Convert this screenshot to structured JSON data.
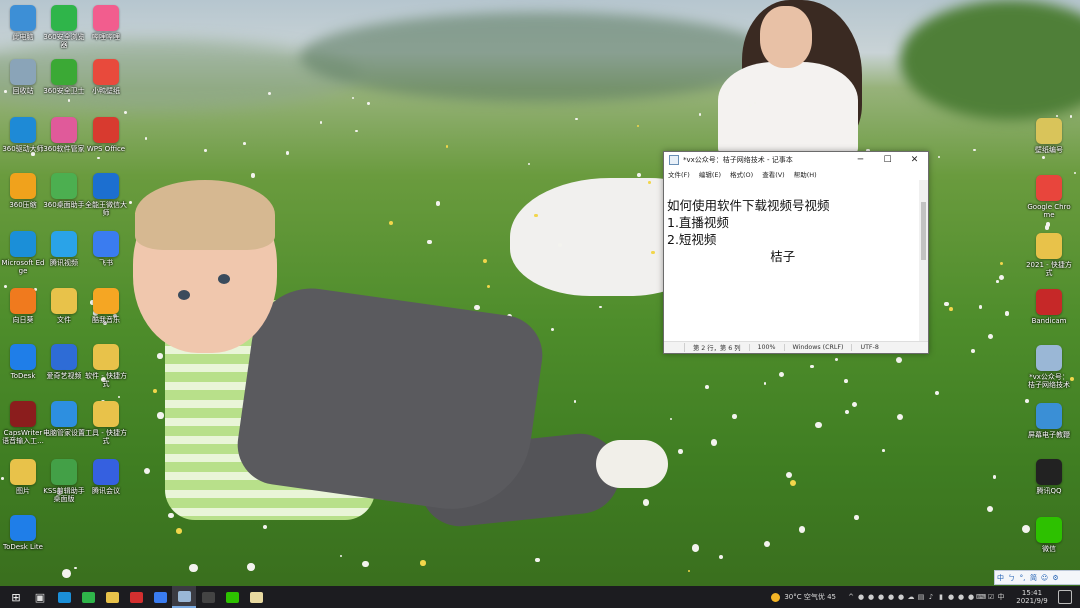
{
  "desktop": {
    "icons": [
      {
        "label": "此电脑",
        "icon": "computer-icon",
        "color": "#3d8fd6"
      },
      {
        "label": "360安全浏览器",
        "icon": "browser-360-icon",
        "color": "#2fb54a"
      },
      {
        "label": "哔哩哔哩",
        "icon": "bilibili-icon",
        "color": "#f25d8e"
      },
      {
        "label": "回收站",
        "icon": "recycle-bin-icon",
        "color": "#8aa4b8"
      },
      {
        "label": "360安全卫士",
        "icon": "security-360-icon",
        "color": "#3ba935"
      },
      {
        "label": "小鸭壁纸",
        "icon": "wallpaper-app-icon",
        "color": "#e84a3c"
      },
      {
        "label": "360驱动大师",
        "icon": "driver-360-icon",
        "color": "#1e8ad6"
      },
      {
        "label": "360软件管家",
        "icon": "software-manager-icon",
        "color": "#e05a9a"
      },
      {
        "label": "WPS Office",
        "icon": "wps-office-icon",
        "color": "#d83a2f"
      },
      {
        "label": "360压缩",
        "icon": "compress-360-icon",
        "color": "#f0a21c"
      },
      {
        "label": "360桌面助手",
        "icon": "desktop-assistant-icon",
        "color": "#4caf50"
      },
      {
        "label": "全能王微信大师",
        "icon": "wechat-master-icon",
        "color": "#1c6fd0"
      },
      {
        "label": "Microsoft Edge",
        "icon": "edge-icon",
        "color": "#1b8fd8"
      },
      {
        "label": "腾讯视频",
        "icon": "tencent-video-icon",
        "color": "#2aa3e8"
      },
      {
        "label": "飞书",
        "icon": "feishu-icon",
        "color": "#3a7cf0"
      },
      {
        "label": "向日葵",
        "icon": "sunflower-icon",
        "color": "#f07a1e"
      },
      {
        "label": "文件",
        "icon": "folder-icon",
        "color": "#e8c24a"
      },
      {
        "label": "酷我音乐",
        "icon": "kuwo-music-icon",
        "color": "#f5a623"
      },
      {
        "label": "ToDesk",
        "icon": "todesk-icon",
        "color": "#1f7ee8"
      },
      {
        "label": "爱奇艺视频",
        "icon": "iqiyi-icon",
        "color": "#2e6cd6"
      },
      {
        "label": "软件 - 快捷方式",
        "icon": "shortcut-folder-icon",
        "color": "#e8c24a"
      },
      {
        "label": "CapsWriter 语音输入工...",
        "icon": "capswriter-icon",
        "color": "#8b1d1d"
      },
      {
        "label": "电脑管家设置",
        "icon": "pc-manager-icon",
        "color": "#2d8fe0"
      },
      {
        "label": "工具 - 快捷方式",
        "icon": "tools-folder-icon",
        "color": "#e8c24a"
      },
      {
        "label": "图片",
        "icon": "pictures-folder-icon",
        "color": "#e8c24a"
      },
      {
        "label": "KSS剪辑助手桌面版",
        "icon": "kss-icon",
        "color": "#43a047"
      },
      {
        "label": "腾讯会议",
        "icon": "tencent-meeting-icon",
        "color": "#3560e0"
      },
      {
        "label": "ToDesk Lite",
        "icon": "todesk-lite-icon",
        "color": "#1f7ee8"
      }
    ],
    "right_icons": [
      {
        "label": "壁纸编号",
        "icon": "file-icon",
        "color": "#d9c45a"
      },
      {
        "label": "Google Chrome",
        "icon": "chrome-icon",
        "color": "#e8453c"
      },
      {
        "label": "2021 - 快捷方式",
        "icon": "folder-shortcut-icon",
        "color": "#e8c24a"
      },
      {
        "label": "Bandicam",
        "icon": "bandicam-icon",
        "color": "#c62828"
      },
      {
        "label": "*vx公众号：桔子网络技术",
        "icon": "text-file-icon",
        "color": "#9ab7d6"
      },
      {
        "label": "屏幕电子教鞭",
        "icon": "screen-pen-icon",
        "color": "#3a8fd6"
      },
      {
        "label": "腾讯QQ",
        "icon": "qq-icon",
        "color": "#222"
      },
      {
        "label": "微信",
        "icon": "wechat-icon",
        "color": "#2dc100"
      }
    ]
  },
  "notepad": {
    "title": "*vx公众号：桔子网络技术 - 记事本",
    "menu": [
      "文件(F)",
      "编辑(E)",
      "格式(O)",
      "查看(V)",
      "帮助(H)"
    ],
    "content": [
      "如何使用软件下载视频号视频",
      "",
      "1.直播视频",
      "2.短视频",
      "                          桔子"
    ],
    "status": {
      "position": "第 2 行，第 6 列",
      "zoom": "100%",
      "line_ending": "Windows (CRLF)",
      "encoding": "UTF-8"
    },
    "controls": {
      "minimize": "─",
      "maximize": "☐",
      "close": "✕"
    }
  },
  "taskbar": {
    "apps": [
      {
        "icon": "windows-start-icon",
        "glyph": "⊞",
        "color": "#ffffff"
      },
      {
        "icon": "task-view-icon",
        "glyph": "▣",
        "color": "#dddddd"
      },
      {
        "icon": "edge-icon",
        "glyph": "",
        "color": "#1b8fd8"
      },
      {
        "icon": "browser-360-icon",
        "glyph": "",
        "color": "#2fb54a"
      },
      {
        "icon": "file-explorer-icon",
        "glyph": "",
        "color": "#e8c24a"
      },
      {
        "icon": "record-icon",
        "glyph": "",
        "color": "#d32f2f"
      },
      {
        "icon": "feishu-icon",
        "glyph": "",
        "color": "#3a7cf0"
      },
      {
        "icon": "notepad-icon",
        "glyph": "",
        "color": "#9ab7d6"
      },
      {
        "icon": "capcut-icon",
        "glyph": "",
        "color": "#444444"
      },
      {
        "icon": "wechat-icon",
        "glyph": "",
        "color": "#2dc100"
      },
      {
        "icon": "image-viewer-icon",
        "glyph": "",
        "color": "#e8d9a0"
      }
    ],
    "weather": "30°C 空气优 45",
    "time": "15:41",
    "date": "2021/9/9",
    "ime": [
      "中",
      "ㄅ",
      "°,",
      "简",
      "☺",
      "⚙"
    ]
  }
}
